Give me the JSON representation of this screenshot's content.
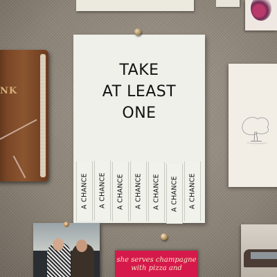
{
  "poster": {
    "title_lines": [
      "TAKE",
      "AT LEAST",
      "ONE"
    ],
    "tabs": [
      "A CHANCE",
      "A CHANCE",
      "A CHANCE",
      "A CHANCE",
      "A CHANCE",
      "A CHANCE",
      "A CHANCE"
    ]
  },
  "notebook": {
    "label": "NK"
  },
  "pink_card": {
    "lines": [
      "she serves champagne",
      "with pizza and"
    ]
  },
  "colors": {
    "pink_card": "#d5194b",
    "poster_paper": "#eef0e9",
    "corkboard": "#8d8478"
  }
}
